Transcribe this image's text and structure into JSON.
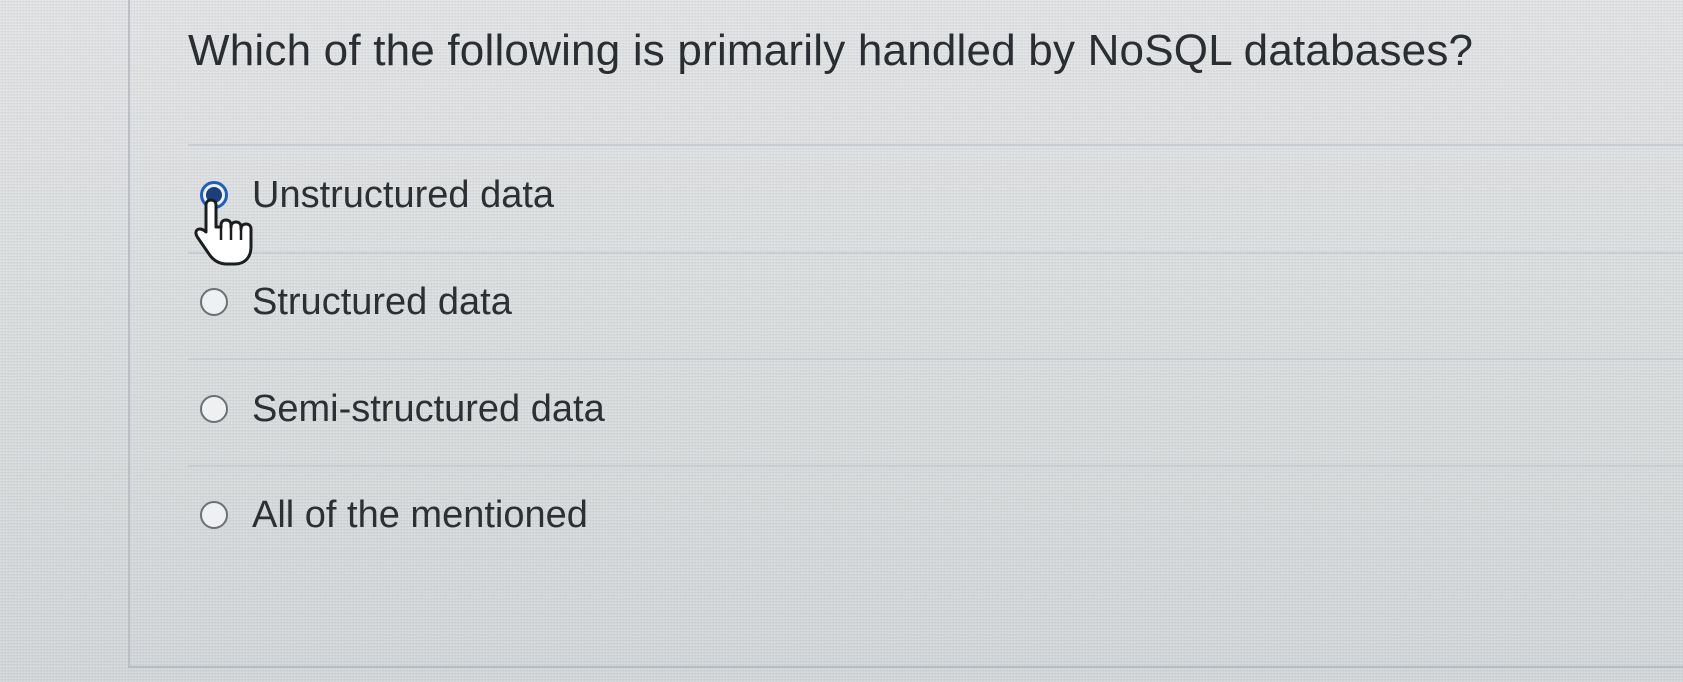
{
  "question": {
    "text": "Which of the following is primarily handled by NoSQL databases?"
  },
  "options": [
    {
      "label": "Unstructured data",
      "selected": true
    },
    {
      "label": "Structured data",
      "selected": false
    },
    {
      "label": "Semi-structured data",
      "selected": false
    },
    {
      "label": "All of the mentioned",
      "selected": false
    }
  ],
  "colors": {
    "radio_selected": "#1b3f7d",
    "text": "#2c2f33",
    "divider": "#c7cdd3"
  },
  "icons": {
    "cursor": "hand-pointer-icon"
  }
}
